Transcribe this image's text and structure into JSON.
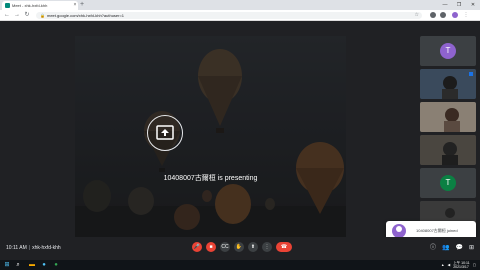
{
  "browser": {
    "tab_title": "Meet - xhk-hxfd-khh",
    "tab_close": "×",
    "new_tab": "+",
    "window_controls": [
      "—",
      "❐",
      "✕"
    ],
    "url": "meet.google.com/xhk-hxfd-khh?authuser=1",
    "lock": "🔒",
    "nav": {
      "back": "←",
      "forward": "→",
      "reload": "↻"
    }
  },
  "meet": {
    "presenting_text": "10408007古爾桓 is presenting",
    "participants": [
      {
        "initial": "T",
        "color": "#8e63ce",
        "name": ""
      },
      {
        "initial": "",
        "color": "#5f6368",
        "name": ""
      },
      {
        "initial": "",
        "color": "#5f6368",
        "name": ""
      },
      {
        "initial": "",
        "color": "#5f6368",
        "name": ""
      },
      {
        "initial": "T",
        "color": "#0b8043",
        "name": ""
      },
      {
        "initial": "",
        "color": "#5f6368",
        "name": ""
      }
    ],
    "notification": "10408007古爾桓 joined",
    "time": "10:11 AM",
    "meeting_code": "xhk-hxfd-khh"
  },
  "controls": {
    "mic": "🎤",
    "cam": "■",
    "captions": "CC",
    "hand": "✋",
    "present": "⬆",
    "more": "⋮",
    "end": "☎",
    "info": "ⓘ",
    "people": "👥",
    "chat": "💬",
    "activities": "⊞"
  },
  "taskbar": {
    "start": "⊞",
    "search": "⌕",
    "time": "上午 10:11",
    "date": "2021/3/17"
  },
  "colors": {
    "meet_bg": "#202124",
    "end_call": "#ea4335",
    "avatar_purple": "#8e63ce"
  }
}
